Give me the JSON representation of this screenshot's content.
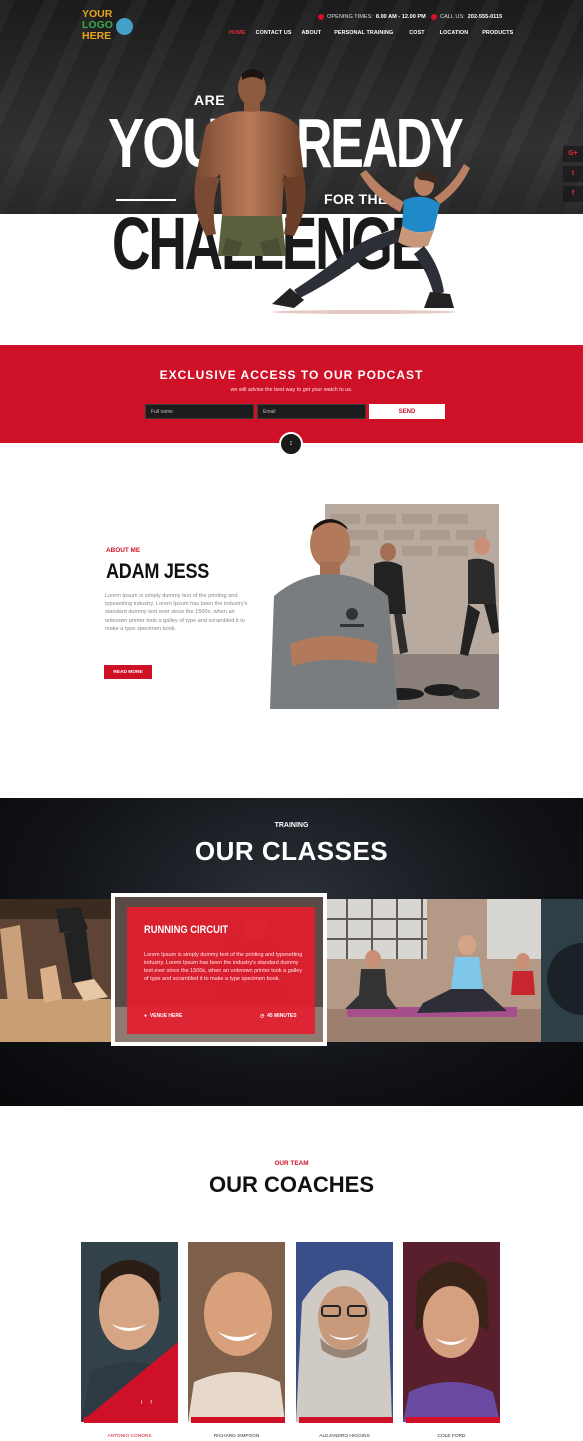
{
  "brand": {
    "logo_lines": [
      "YOUR",
      "LOGO",
      "HERE"
    ]
  },
  "topbar": {
    "hours_label": "OPENING TIMES:",
    "hours_value": "8.00 AM - 12.00 PM",
    "phone_label": "CALL US:",
    "phone_value": "202-555-0115"
  },
  "nav": {
    "items": [
      "HOME",
      "CONTACT US",
      "ABOUT",
      "PERSONAL TRAINING",
      "COST",
      "LOCATION",
      "PRODUCTS"
    ],
    "active": "HOME"
  },
  "social": {
    "items": [
      "G+",
      "t",
      "f"
    ]
  },
  "hero": {
    "line1": "ARE",
    "line2a": "YOU",
    "line2b": "READY",
    "line3": "FOR THE",
    "line4": "CHALLENGE"
  },
  "podcast": {
    "title": "EXCLUSIVE ACCESS TO OUR PODCAST",
    "subtitle": "we will advise the best way to get your watch to us.",
    "name_placeholder": "Full name",
    "email_placeholder": "Email",
    "send_label": "SEND"
  },
  "about": {
    "kicker": "ABOUT ME",
    "name": "ADAM JESS",
    "text": "Lorem Ipsum is simply dummy text of the printing and typesetting industry. Lorem Ipsum has been the industry's standard dummy text ever since the 1500s, when an unknown printer took a galley of type and scrambled it to make a type specimen book.",
    "button": "READ MORE"
  },
  "classes": {
    "kicker": "TRAINING",
    "title": "OUR CLASSES",
    "featured": {
      "name": "RUNNING CIRCUIT",
      "text": "Lorem Ipsum is simply dummy text of the printing and typesetting industry. Lorem Ipsum has been the industry's standard dummy text ever since the 1500s, when an unknown printer took a galley of type and scrambled it to make a type specimen book.",
      "venue": "VENUE HERE",
      "duration": "45 MINUTES"
    }
  },
  "coaches": {
    "kicker": "OUR TEAM",
    "title": "OUR COACHES",
    "items": [
      {
        "name": "ANTONIO CONORS"
      },
      {
        "name": "RICHARD SIMPSON"
      },
      {
        "name": "ALEJANDRO HIGGINS"
      },
      {
        "name": "COLE FORD"
      }
    ]
  },
  "colors": {
    "accent": "#cf1128",
    "dark": "#1a1a1a"
  }
}
